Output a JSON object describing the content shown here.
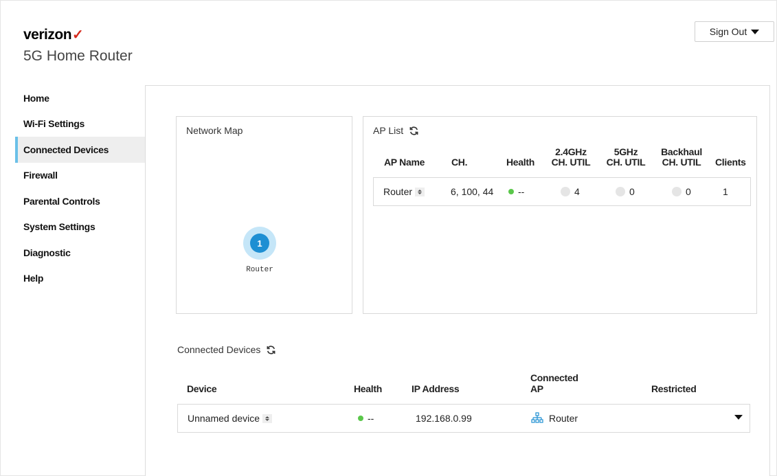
{
  "brand": {
    "logo_text": "verizon",
    "logo_check": "✓",
    "product": "5G Home Router"
  },
  "header": {
    "signout_label": "Sign Out"
  },
  "sidebar": {
    "items": [
      {
        "label": "Home"
      },
      {
        "label": "Wi-Fi Settings"
      },
      {
        "label": "Connected Devices",
        "active": true
      },
      {
        "label": "Firewall"
      },
      {
        "label": "Parental Controls"
      },
      {
        "label": "System Settings"
      },
      {
        "label": "Diagnostic"
      },
      {
        "label": "Help"
      }
    ]
  },
  "network_map": {
    "title": "Network Map",
    "node": {
      "number": "1",
      "label": "Router"
    }
  },
  "ap_list": {
    "title": "AP List",
    "columns": {
      "name": "AP Name",
      "channel": "CH.",
      "health": "Health",
      "util_24_line1": "2.4GHz",
      "util_24_line2": "CH. UTIL",
      "util_5_line1": "5GHz",
      "util_5_line2": "CH. UTIL",
      "backhaul_line1": "Backhaul",
      "backhaul_line2": "CH. UTIL",
      "clients": "Clients"
    },
    "rows": [
      {
        "name": "Router",
        "channel": "6, 100, 44",
        "health": "--",
        "util_24": "4",
        "util_5": "0",
        "backhaul": "0",
        "clients": "1"
      }
    ]
  },
  "connected_devices": {
    "title": "Connected Devices",
    "columns": {
      "device": "Device",
      "health": "Health",
      "ip": "IP Address",
      "ap_line1": "Connected",
      "ap_line2": "AP",
      "restricted": "Restricted"
    },
    "rows": [
      {
        "device": "Unnamed device",
        "health": "--",
        "ip": "192.168.0.99",
        "ap": "Router"
      }
    ]
  },
  "colors": {
    "accent": "#1e8fd3",
    "active_bar": "#6bc0e8",
    "brand_red": "#d52b1e",
    "healthy": "#5ac74a"
  }
}
